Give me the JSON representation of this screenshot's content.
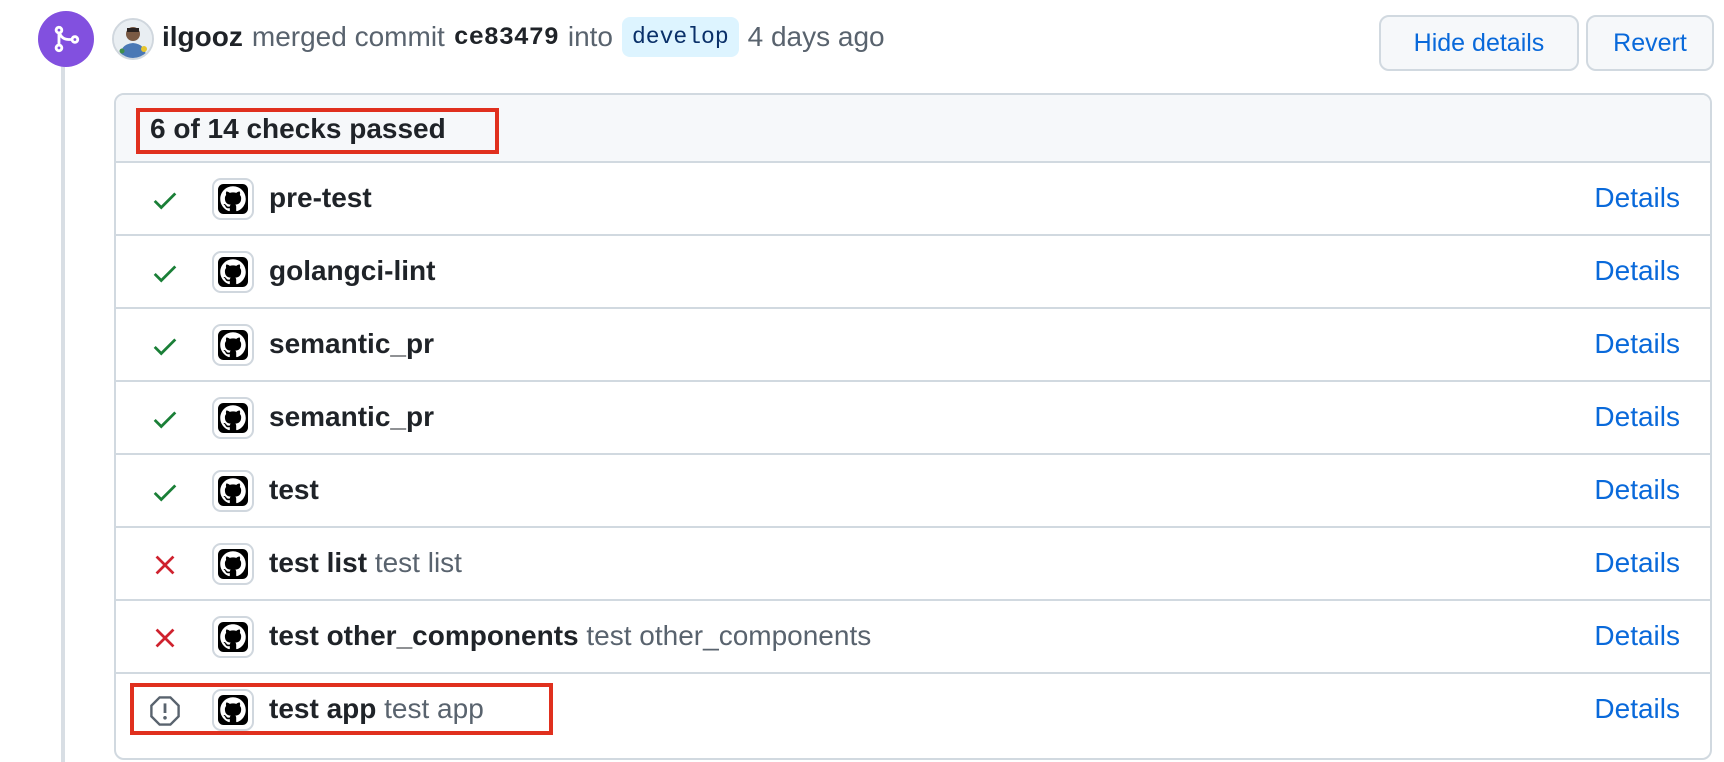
{
  "event": {
    "author": "ilgooz",
    "action_text": "merged commit",
    "commit_sha": "ce83479",
    "into_text": "into",
    "branch": "develop",
    "time_ago": "4 days ago"
  },
  "buttons": {
    "hide_details": "Hide details",
    "revert": "Revert"
  },
  "checks": {
    "summary": "6 of 14 checks passed",
    "rows": [
      {
        "name": "pre-test",
        "description": "",
        "status": "success",
        "link": "Details"
      },
      {
        "name": "golangci-lint",
        "description": "",
        "status": "success",
        "link": "Details"
      },
      {
        "name": "semantic_pr",
        "description": "",
        "status": "success",
        "link": "Details"
      },
      {
        "name": "semantic_pr",
        "description": "",
        "status": "success",
        "link": "Details"
      },
      {
        "name": "test",
        "description": "",
        "status": "success",
        "link": "Details"
      },
      {
        "name": "test list",
        "description": "test list",
        "status": "failure",
        "link": "Details"
      },
      {
        "name": "test other_components",
        "description": "test other_components",
        "status": "failure",
        "link": "Details"
      },
      {
        "name": "test app",
        "description": "test app",
        "status": "warning",
        "link": "Details"
      }
    ]
  },
  "colors": {
    "success": "#1a7f37",
    "failure": "#cf222e",
    "warning": "#59636e",
    "link": "#0969da",
    "merged": "#8250df",
    "highlight": "#e0301e"
  },
  "icons": {
    "merge": "git-merge-icon",
    "success": "check-icon",
    "failure": "x-icon",
    "warning": "alert-octagon-icon",
    "app": "github-logo-icon"
  }
}
